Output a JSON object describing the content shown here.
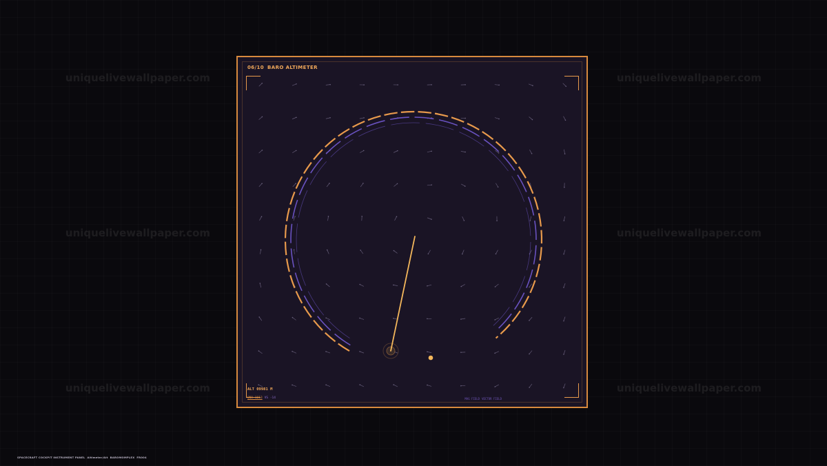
{
  "panel": {
    "index": "06/10",
    "title": "BARO ALTIMETER",
    "altitude": "ALT 09981 M",
    "qnh": "QNH 1013",
    "vs": "VS -14",
    "mode_a": "MAG FIELD",
    "mode_b": "VECTOR FIELD"
  },
  "footer": {
    "caption_a": "SPACECRAFT COCKPIT INSTRUMENT PANEL",
    "caption_b": "Altimeter/Alt",
    "caption_c": "BAROMOMPLEX",
    "caption_d": "FR004"
  },
  "watermark": {
    "text": "uniquelivewallpaper.com"
  },
  "gauge": {
    "needle_angle_deg": 194,
    "sweep_start_deg": 210,
    "sweep_end_deg": 140
  },
  "colors": {
    "accent_orange": "#e89a4c",
    "accent_violet": "#6e55c8",
    "needle": "#f5b85c",
    "panel_bg": "#1a1425",
    "page_bg": "#0a090d"
  }
}
